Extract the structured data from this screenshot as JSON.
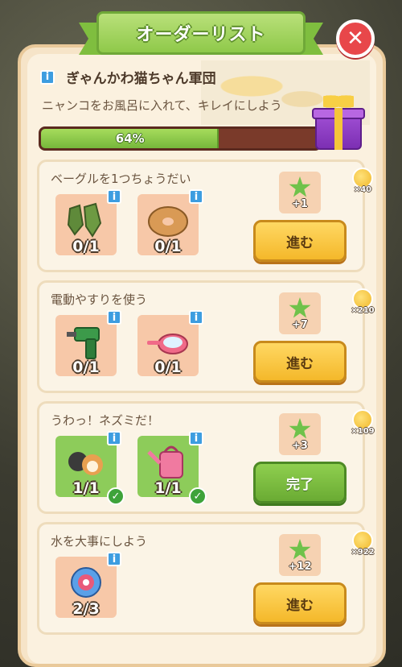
{
  "title": "オーダーリスト",
  "close_icon": "close-icon",
  "team": {
    "name": "ぎゃんかわ猫ちゃん軍団",
    "info": "i"
  },
  "description": "ニャンコをお風呂に入れて、キレイにしよう",
  "progress": {
    "value": 0.64,
    "label": "64%"
  },
  "orders": [
    {
      "title": "ベーグルを1つちょうだい",
      "items": [
        {
          "icon": "gloves-icon",
          "count": "0/1",
          "done": false
        },
        {
          "icon": "bagel-icon",
          "count": "0/1",
          "done": false
        }
      ],
      "reward": "+1",
      "button": "進む",
      "coin": "×40"
    },
    {
      "title": "電動やすりを使う",
      "items": [
        {
          "icon": "drill-icon",
          "count": "0/1",
          "done": false
        },
        {
          "icon": "pan-icon",
          "count": "0/1",
          "done": false
        }
      ],
      "reward": "+7",
      "button": "進む",
      "coin": "×210"
    },
    {
      "title": "うわっ！ネズミだ！",
      "items": [
        {
          "icon": "mice-icon",
          "count": "1/1",
          "done": true
        },
        {
          "icon": "watering-can-icon",
          "count": "1/1",
          "done": true
        }
      ],
      "reward": "+3",
      "button": "完了",
      "coin": "×109"
    },
    {
      "title": "水を大事にしよう",
      "items": [
        {
          "icon": "hose-reel-icon",
          "count": "2/3",
          "done": false
        }
      ],
      "reward": "+12",
      "button": "進む",
      "coin": "×922"
    }
  ]
}
